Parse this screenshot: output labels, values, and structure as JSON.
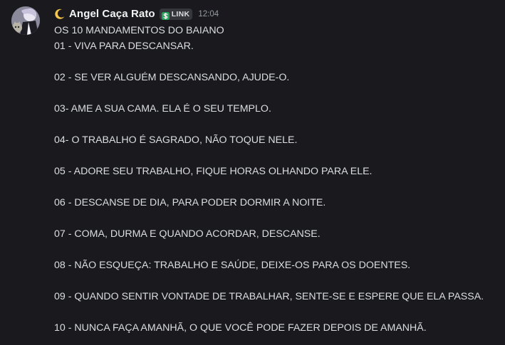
{
  "message": {
    "username": "Angel Caça Rato",
    "username_icon": "crescent-moon-emoji",
    "tag": {
      "icon": "clan-badge-icon",
      "label": "LINK"
    },
    "timestamp": "12:04",
    "title": "OS 10 MANDAMENTOS DO BAIANO",
    "lines": [
      "01 - VIVA PARA DESCANSAR.",
      "02 - SE VER ALGUÉM DESCANSANDO, AJUDE-O.",
      "03- AME A SUA CAMA. ELA É O SEU TEMPLO.",
      "04- O TRABALHO É SAGRADO, NÃO TOQUE NELE.",
      "05 - ADORE SEU TRABALHO, FIQUE HORAS OLHANDO PARA ELE.",
      "06 - DESCANSE DE DIA, PARA PODER DORMIR A NOITE.",
      "07 - COMA, DURMA E QUANDO ACORDAR, DESCANSE.",
      "08 - NÃO ESQUEÇA: TRABALHO E SAÚDE, DEIXE-OS PARA OS DOENTES.",
      "09 - QUANDO SENTIR VONTADE DE TRABALHAR, SENTE-SE E ESPERE QUE ELA PASSA.",
      "10 - NUNCA FAÇA AMANHÃ, O QUE VOCÊ PODE FAZER DEPOIS DE AMANHÃ."
    ]
  },
  "colors": {
    "background": "#1a1a1e",
    "text": "#dbdee1",
    "username": "#f2f3f5",
    "timestamp": "#949ba4",
    "tag_background": "#35373d",
    "tag_icon": "#23a55a"
  }
}
